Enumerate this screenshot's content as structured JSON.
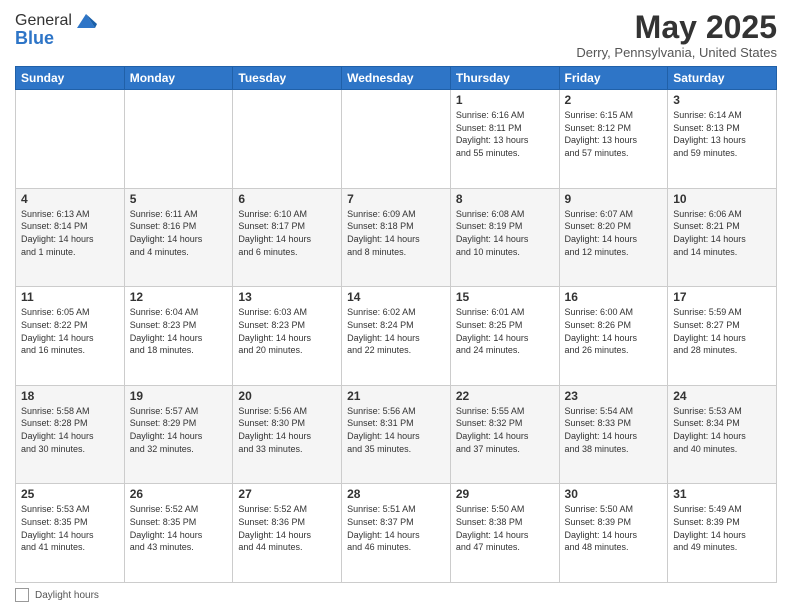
{
  "header": {
    "logo_line1": "General",
    "logo_line2": "Blue",
    "month_title": "May 2025",
    "location": "Derry, Pennsylvania, United States"
  },
  "days_of_week": [
    "Sunday",
    "Monday",
    "Tuesday",
    "Wednesday",
    "Thursday",
    "Friday",
    "Saturday"
  ],
  "weeks": [
    [
      {
        "day": "",
        "text": ""
      },
      {
        "day": "",
        "text": ""
      },
      {
        "day": "",
        "text": ""
      },
      {
        "day": "",
        "text": ""
      },
      {
        "day": "1",
        "text": "Sunrise: 6:16 AM\nSunset: 8:11 PM\nDaylight: 13 hours\nand 55 minutes."
      },
      {
        "day": "2",
        "text": "Sunrise: 6:15 AM\nSunset: 8:12 PM\nDaylight: 13 hours\nand 57 minutes."
      },
      {
        "day": "3",
        "text": "Sunrise: 6:14 AM\nSunset: 8:13 PM\nDaylight: 13 hours\nand 59 minutes."
      }
    ],
    [
      {
        "day": "4",
        "text": "Sunrise: 6:13 AM\nSunset: 8:14 PM\nDaylight: 14 hours\nand 1 minute."
      },
      {
        "day": "5",
        "text": "Sunrise: 6:11 AM\nSunset: 8:16 PM\nDaylight: 14 hours\nand 4 minutes."
      },
      {
        "day": "6",
        "text": "Sunrise: 6:10 AM\nSunset: 8:17 PM\nDaylight: 14 hours\nand 6 minutes."
      },
      {
        "day": "7",
        "text": "Sunrise: 6:09 AM\nSunset: 8:18 PM\nDaylight: 14 hours\nand 8 minutes."
      },
      {
        "day": "8",
        "text": "Sunrise: 6:08 AM\nSunset: 8:19 PM\nDaylight: 14 hours\nand 10 minutes."
      },
      {
        "day": "9",
        "text": "Sunrise: 6:07 AM\nSunset: 8:20 PM\nDaylight: 14 hours\nand 12 minutes."
      },
      {
        "day": "10",
        "text": "Sunrise: 6:06 AM\nSunset: 8:21 PM\nDaylight: 14 hours\nand 14 minutes."
      }
    ],
    [
      {
        "day": "11",
        "text": "Sunrise: 6:05 AM\nSunset: 8:22 PM\nDaylight: 14 hours\nand 16 minutes."
      },
      {
        "day": "12",
        "text": "Sunrise: 6:04 AM\nSunset: 8:23 PM\nDaylight: 14 hours\nand 18 minutes."
      },
      {
        "day": "13",
        "text": "Sunrise: 6:03 AM\nSunset: 8:23 PM\nDaylight: 14 hours\nand 20 minutes."
      },
      {
        "day": "14",
        "text": "Sunrise: 6:02 AM\nSunset: 8:24 PM\nDaylight: 14 hours\nand 22 minutes."
      },
      {
        "day": "15",
        "text": "Sunrise: 6:01 AM\nSunset: 8:25 PM\nDaylight: 14 hours\nand 24 minutes."
      },
      {
        "day": "16",
        "text": "Sunrise: 6:00 AM\nSunset: 8:26 PM\nDaylight: 14 hours\nand 26 minutes."
      },
      {
        "day": "17",
        "text": "Sunrise: 5:59 AM\nSunset: 8:27 PM\nDaylight: 14 hours\nand 28 minutes."
      }
    ],
    [
      {
        "day": "18",
        "text": "Sunrise: 5:58 AM\nSunset: 8:28 PM\nDaylight: 14 hours\nand 30 minutes."
      },
      {
        "day": "19",
        "text": "Sunrise: 5:57 AM\nSunset: 8:29 PM\nDaylight: 14 hours\nand 32 minutes."
      },
      {
        "day": "20",
        "text": "Sunrise: 5:56 AM\nSunset: 8:30 PM\nDaylight: 14 hours\nand 33 minutes."
      },
      {
        "day": "21",
        "text": "Sunrise: 5:56 AM\nSunset: 8:31 PM\nDaylight: 14 hours\nand 35 minutes."
      },
      {
        "day": "22",
        "text": "Sunrise: 5:55 AM\nSunset: 8:32 PM\nDaylight: 14 hours\nand 37 minutes."
      },
      {
        "day": "23",
        "text": "Sunrise: 5:54 AM\nSunset: 8:33 PM\nDaylight: 14 hours\nand 38 minutes."
      },
      {
        "day": "24",
        "text": "Sunrise: 5:53 AM\nSunset: 8:34 PM\nDaylight: 14 hours\nand 40 minutes."
      }
    ],
    [
      {
        "day": "25",
        "text": "Sunrise: 5:53 AM\nSunset: 8:35 PM\nDaylight: 14 hours\nand 41 minutes."
      },
      {
        "day": "26",
        "text": "Sunrise: 5:52 AM\nSunset: 8:35 PM\nDaylight: 14 hours\nand 43 minutes."
      },
      {
        "day": "27",
        "text": "Sunrise: 5:52 AM\nSunset: 8:36 PM\nDaylight: 14 hours\nand 44 minutes."
      },
      {
        "day": "28",
        "text": "Sunrise: 5:51 AM\nSunset: 8:37 PM\nDaylight: 14 hours\nand 46 minutes."
      },
      {
        "day": "29",
        "text": "Sunrise: 5:50 AM\nSunset: 8:38 PM\nDaylight: 14 hours\nand 47 minutes."
      },
      {
        "day": "30",
        "text": "Sunrise: 5:50 AM\nSunset: 8:39 PM\nDaylight: 14 hours\nand 48 minutes."
      },
      {
        "day": "31",
        "text": "Sunrise: 5:49 AM\nSunset: 8:39 PM\nDaylight: 14 hours\nand 49 minutes."
      }
    ]
  ],
  "footer": {
    "daylight_label": "Daylight hours"
  }
}
